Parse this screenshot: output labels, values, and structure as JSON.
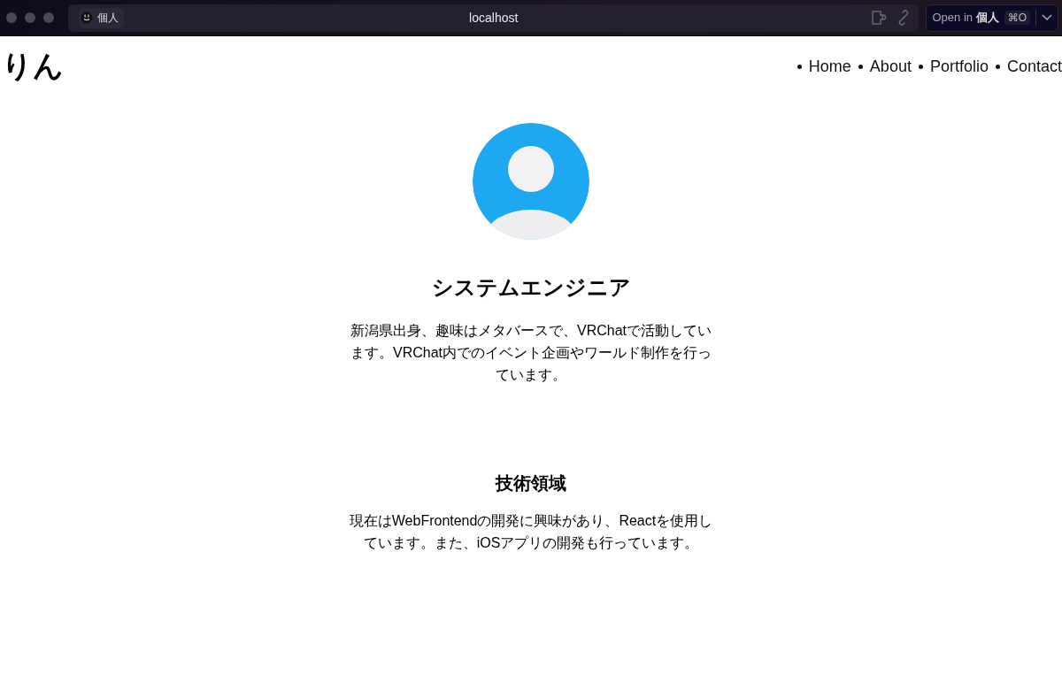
{
  "browser": {
    "profile": "個人",
    "address": "localhost",
    "open_in": {
      "label": "Open in",
      "profile": "個人",
      "shortcut": "⌘O"
    }
  },
  "header": {
    "logo": "りん",
    "nav": [
      {
        "label": "Home"
      },
      {
        "label": "About"
      },
      {
        "label": "Portfolio"
      },
      {
        "label": "Contact"
      }
    ]
  },
  "profile": {
    "title": "システムエンジニア",
    "bio": "新潟県出身、趣味はメタバースで、VRChatで活動しています。VRChat内でのイベント企画やワールド制作を行っています。"
  },
  "sections": [
    {
      "heading": "技術領域",
      "text": "現在はWebFrontendの開発に興味があり、Reactを使用しています。また、iOSアプリの開発も行っています。"
    }
  ]
}
